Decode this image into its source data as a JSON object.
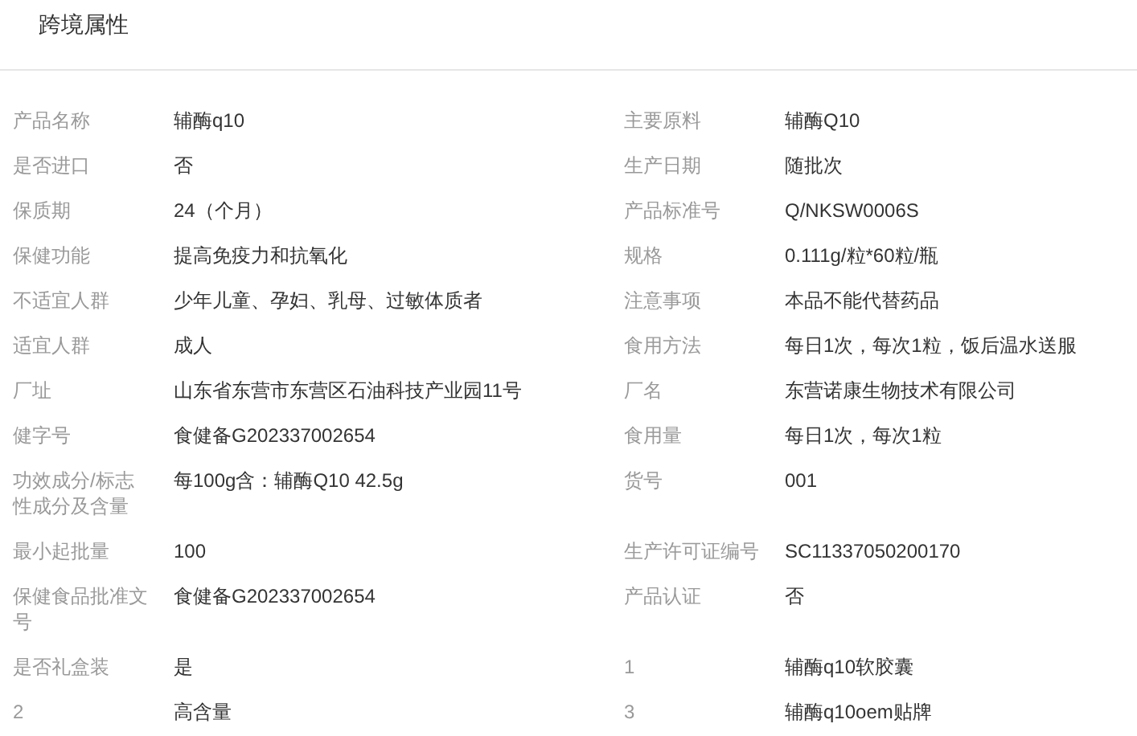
{
  "section": {
    "title": "跨境属性"
  },
  "attributes": [
    {
      "label": "产品名称",
      "value": "辅酶q10"
    },
    {
      "label": "主要原料",
      "value": "辅酶Q10"
    },
    {
      "label": "是否进口",
      "value": "否"
    },
    {
      "label": "生产日期",
      "value": "随批次"
    },
    {
      "label": "保质期",
      "value": "24（个月）"
    },
    {
      "label": "产品标准号",
      "value": "Q/NKSW0006S"
    },
    {
      "label": "保健功能",
      "value": "提高免疫力和抗氧化"
    },
    {
      "label": "规格",
      "value": "0.111g/粒*60粒/瓶"
    },
    {
      "label": "不适宜人群",
      "value": "少年儿童、孕妇、乳母、过敏体质者"
    },
    {
      "label": "注意事项",
      "value": "本品不能代替药品"
    },
    {
      "label": "适宜人群",
      "value": "成人"
    },
    {
      "label": "食用方法",
      "value": "每日1次，每次1粒，饭后温水送服"
    },
    {
      "label": "厂址",
      "value": "山东省东营市东营区石油科技产业园11号"
    },
    {
      "label": "厂名",
      "value": "东营诺康生物技术有限公司"
    },
    {
      "label": "健字号",
      "value": "食健备G202337002654"
    },
    {
      "label": "食用量",
      "value": "每日1次，每次1粒"
    },
    {
      "label": "功效成分/标志性成分及含量",
      "value": "每100g含：辅酶Q10 42.5g"
    },
    {
      "label": "货号",
      "value": "001"
    },
    {
      "label": "最小起批量",
      "value": "100"
    },
    {
      "label": "生产许可证编号",
      "value": "SC11337050200170"
    },
    {
      "label": "保健食品批准文号",
      "value": "食健备G202337002654"
    },
    {
      "label": "产品认证",
      "value": "否"
    },
    {
      "label": "是否礼盒装",
      "value": "是"
    },
    {
      "label": "1",
      "value": "辅酶q10软胶囊"
    },
    {
      "label": "2",
      "value": "高含量"
    },
    {
      "label": "3",
      "value": "辅酶q10oem贴牌"
    }
  ]
}
